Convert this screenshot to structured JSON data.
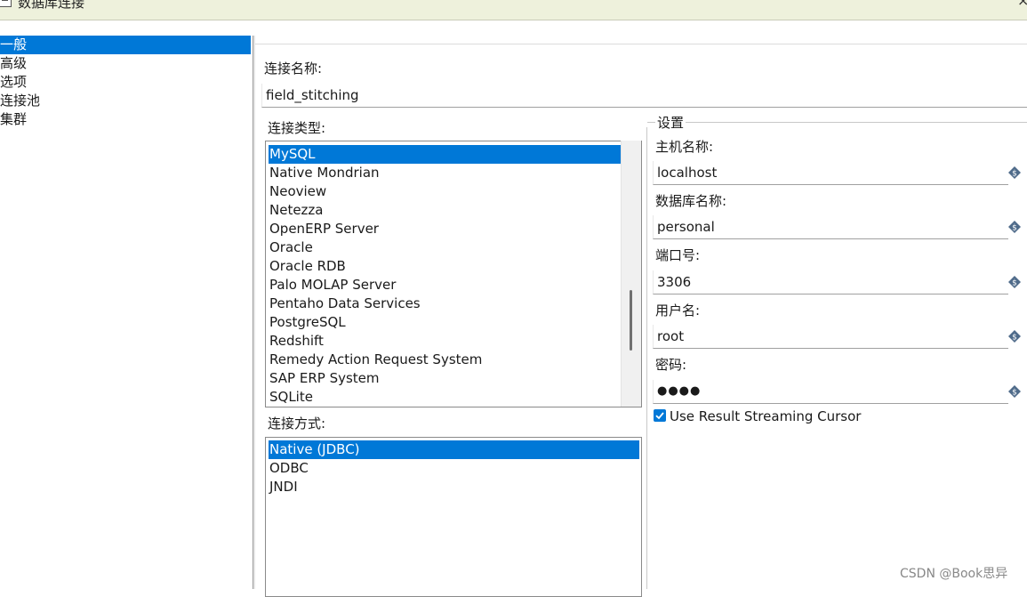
{
  "window": {
    "title": "数据库连接"
  },
  "nav": {
    "items": [
      {
        "label": "一般",
        "selected": true
      },
      {
        "label": "高级",
        "selected": false
      },
      {
        "label": "选项",
        "selected": false
      },
      {
        "label": "连接池",
        "selected": false
      },
      {
        "label": "集群",
        "selected": false
      }
    ]
  },
  "general": {
    "conn_name_label": "连接名称:",
    "conn_name_value": "field_stitching",
    "conn_type_label": "连接类型:",
    "conn_types": [
      "MySQL",
      "Native Mondrian",
      "Neoview",
      "Netezza",
      "OpenERP Server",
      "Oracle",
      "Oracle RDB",
      "Palo MOLAP Server",
      "Pentaho Data Services",
      "PostgreSQL",
      "Redshift",
      "Remedy Action Request System",
      "SAP ERP System",
      "SQLite"
    ],
    "conn_type_selected": "MySQL",
    "access_label": "连接方式:",
    "access_methods": [
      "Native (JDBC)",
      "ODBC",
      "JNDI"
    ],
    "access_selected": "Native (JDBC)"
  },
  "settings": {
    "title": "设置",
    "host_label": "主机名称:",
    "host_value": "localhost",
    "db_label": "数据库名称:",
    "db_value": "personal",
    "port_label": "端口号:",
    "port_value": "3306",
    "user_label": "用户名:",
    "user_value": "root",
    "password_label": "密码:",
    "password_value": "●●●●",
    "streaming_label": "Use Result Streaming Cursor",
    "streaming_checked": true
  },
  "colors": {
    "selection": "#0078d7",
    "titlebar": "#eef1dc",
    "variable_icon": "#4f6b8a"
  },
  "watermark": "CSDN @Book思异"
}
